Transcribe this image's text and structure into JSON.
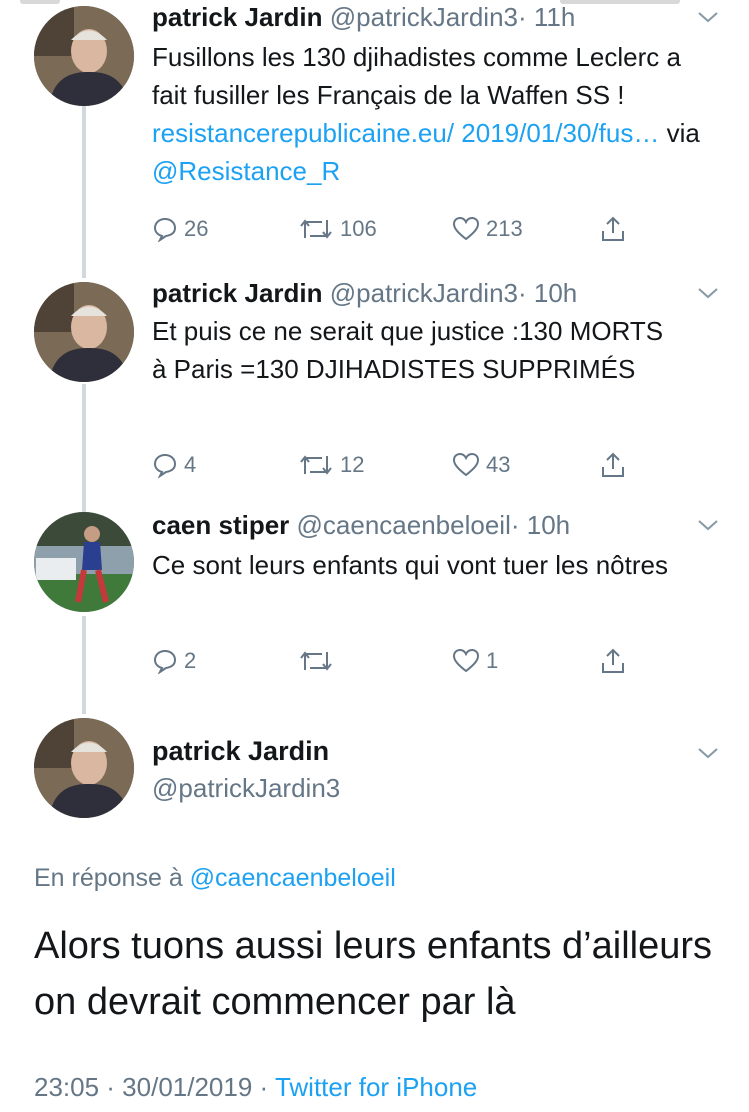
{
  "tweets": [
    {
      "name": "patrick Jardin",
      "handle": "@patrickJardin3",
      "time": "· 11h",
      "text_before_link": "Fusillons les 130 djihadistes comme Leclerc a fait fusiller les Français de la Waffen SS ! ",
      "link": "resistancerepublicaine.eu/ 2019/01/30/fus…",
      "via": " via ",
      "mention": "@Resistance_R",
      "replies": "26",
      "retweets": "106",
      "likes": "213"
    },
    {
      "name": "patrick Jardin",
      "handle": "@patrickJardin3",
      "time": "· 10h",
      "text": "Et puis ce ne serait que justice :130 MORTS à Paris =130 DJIHADISTES SUPPRIMÉS",
      "replies": "4",
      "retweets": "12",
      "likes": "43"
    },
    {
      "name": "caen stiper",
      "handle": "@caencaenbeloeil",
      "time": "· 10h",
      "text": "Ce sont leurs enfants qui vont tuer les nôtres",
      "replies": "2",
      "retweets": "",
      "likes": "1"
    }
  ],
  "focus": {
    "name": "patrick Jardin",
    "handle": "@patrickJardin3",
    "reply_prefix": "En réponse à ",
    "reply_to": "@caencaenbeloeil",
    "text": "Alors tuons aussi leurs enfants d’ailleurs on devrait commencer par là",
    "timestamp": "23:05 · 30/01/2019 · ",
    "source": "Twitter for iPhone"
  },
  "colors": {
    "link": "#1da1f2",
    "secondary": "#657786",
    "thread": "#cfd9de"
  },
  "icons": [
    "reply-icon",
    "retweet-icon",
    "like-icon",
    "share-icon",
    "chevron-down-icon"
  ]
}
